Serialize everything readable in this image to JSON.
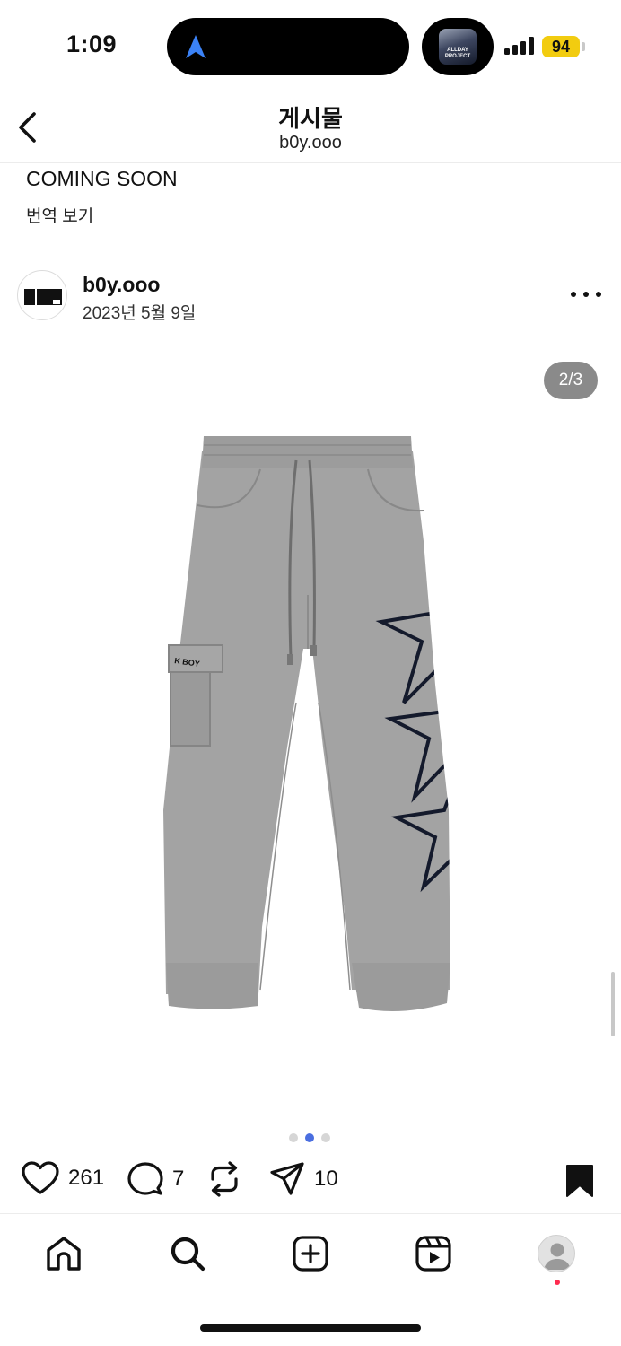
{
  "status_bar": {
    "time": "1:09",
    "battery": "94",
    "album_art_text": "ALLDAY PROJECT",
    "colors": {
      "battery": "#f2cc10",
      "nav_arrow": "#3b82f6"
    }
  },
  "header": {
    "title": "게시물",
    "subtitle": "b0y.ooo"
  },
  "previous_post": {
    "caption": "COMING SOON",
    "translate_label": "번역 보기"
  },
  "post": {
    "username": "b0y.ooo",
    "date": "2023년 5월 9일",
    "media_counter": "2/3",
    "pocket_tag_text": "K BOY",
    "carousel": {
      "count": 3,
      "active_index": 1
    },
    "likes": "261",
    "comments": "7",
    "shares": "10"
  },
  "tabbar": {
    "items": [
      "home-icon",
      "search-icon",
      "create-icon",
      "reels-icon",
      "profile-avatar"
    ]
  }
}
